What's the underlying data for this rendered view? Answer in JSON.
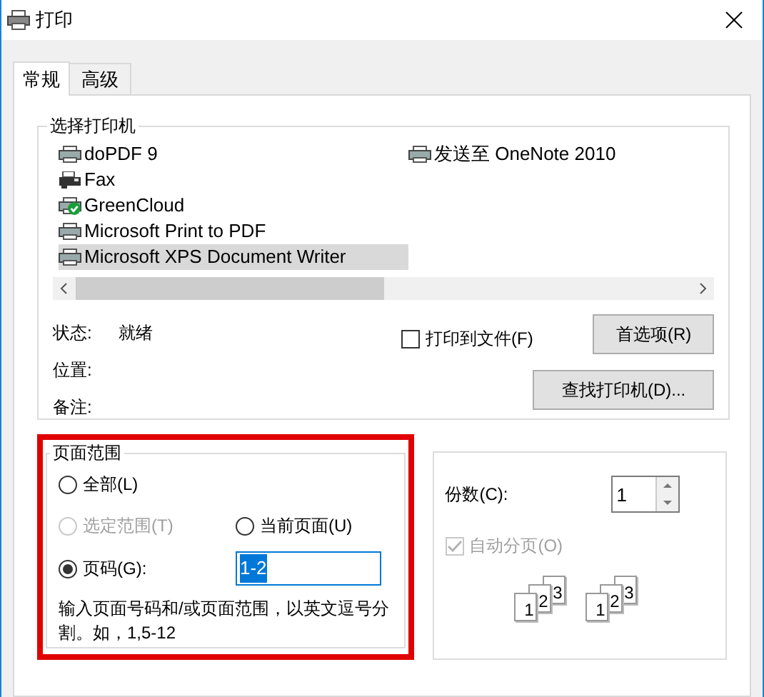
{
  "window": {
    "title": "打印"
  },
  "tabs": [
    {
      "label": "常规",
      "selected": true
    },
    {
      "label": "高级",
      "selected": false
    }
  ],
  "printer_group": {
    "title": "选择打印机",
    "printers": [
      {
        "name": "doPDF 9",
        "kind": "printer",
        "selected": false
      },
      {
        "name": "Fax",
        "kind": "fax",
        "selected": false
      },
      {
        "name": "GreenCloud",
        "kind": "default",
        "selected": false
      },
      {
        "name": "Microsoft Print to PDF",
        "kind": "printer",
        "selected": false
      },
      {
        "name": "Microsoft XPS Document Writer",
        "kind": "printer",
        "selected": true
      },
      {
        "name": "发送至 OneNote 2010",
        "kind": "printer",
        "selected": false
      }
    ],
    "status_label": "状态:",
    "status_value": "就绪",
    "location_label": "位置:",
    "comment_label": "备注:",
    "print_to_file": {
      "label": "打印到文件(F)",
      "checked": false
    },
    "preferences_button": "首选项(R)",
    "find_printer_button": "查找打印机(D)..."
  },
  "page_range": {
    "title": "页面范围",
    "options": [
      {
        "label": "全部(L)",
        "selected": false,
        "disabled": false
      },
      {
        "label": "选定范围(T)",
        "selected": false,
        "disabled": true
      },
      {
        "label": "当前页面(U)",
        "selected": false,
        "disabled": false
      },
      {
        "label": "页码(G):",
        "selected": true,
        "disabled": false
      }
    ],
    "pages_value": "1-2",
    "hint": "输入页面号码和/或页面范围，以英文逗号分割。如，1,5-12"
  },
  "copies": {
    "label": "份数(C):",
    "value": "1",
    "collate": {
      "label": "自动分页(O)",
      "checked": true,
      "disabled": true
    },
    "collate_sets": [
      [
        "1",
        "2",
        "3"
      ],
      [
        "1",
        "2",
        "3"
      ]
    ]
  }
}
